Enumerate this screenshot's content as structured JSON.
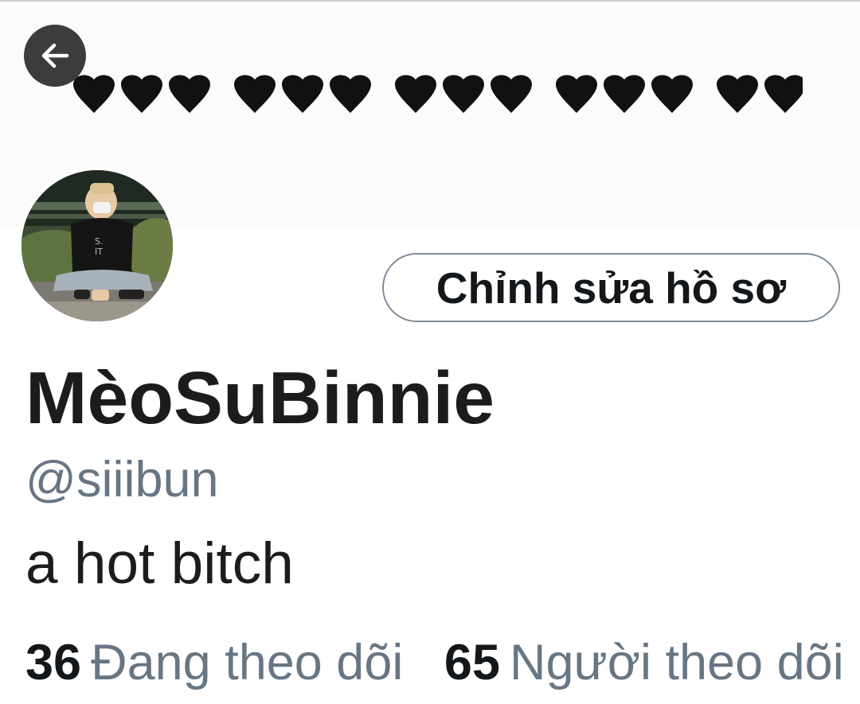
{
  "header": {
    "banner_hearts": 15,
    "banner_heart_color": "#111111",
    "back_icon": "arrow-left-icon"
  },
  "profile": {
    "display_name": "MèoSuBinnie",
    "handle": "@siiibun",
    "bio": "a hot bitch",
    "edit_button_label": "Chỉnh sửa hồ sơ"
  },
  "stats": {
    "following_count": "36",
    "following_label": "Đang theo dõi",
    "followers_count": "65",
    "followers_label": "Người theo dõi"
  },
  "colors": {
    "primary_text": "#14171a",
    "secondary_text": "#687684",
    "button_border": "#7f8c99"
  }
}
